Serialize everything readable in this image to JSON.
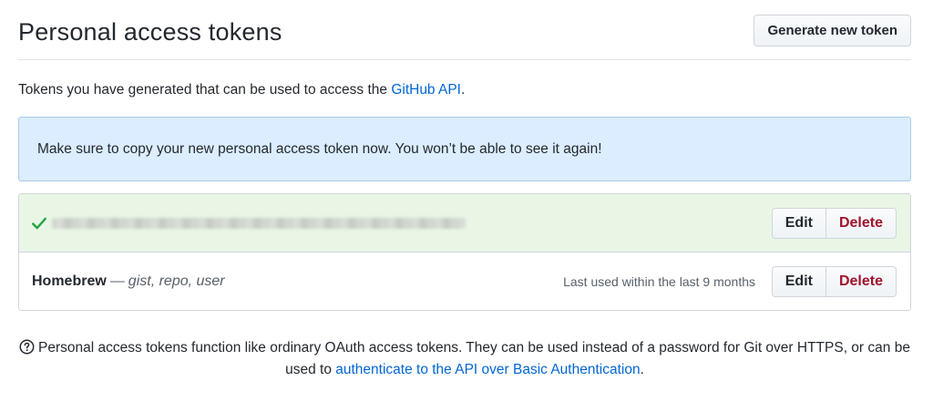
{
  "header": {
    "title": "Personal access tokens",
    "generate_button": "Generate new token"
  },
  "intro": {
    "text_before": "Tokens you have generated that can be used to access the ",
    "link_text": "GitHub API",
    "text_after": "."
  },
  "flash": {
    "message": "Make sure to copy your new personal access token now. You won’t be able to see it again!"
  },
  "tokens": [
    {
      "status_icon": "check-icon",
      "value": "",
      "edit_label": "Edit",
      "delete_label": "Delete"
    },
    {
      "name": "Homebrew",
      "separator": "—",
      "scopes": "gist, repo, user",
      "last_used": "Last used within the last 9 months",
      "edit_label": "Edit",
      "delete_label": "Delete"
    }
  ],
  "footnote": {
    "icon": "question-icon",
    "text_before": "Personal access tokens function like ordinary OAuth access tokens. They can be used instead of a password for Git over HTTPS, or can be used to ",
    "link_text": "authenticate to the API over Basic Authentication",
    "text_after": "."
  },
  "colors": {
    "link": "#0366d6",
    "flash_bg": "#dbedff",
    "new_token_bg": "#e9f6e6",
    "delete_text": "#a0132c",
    "check": "#28a745"
  }
}
